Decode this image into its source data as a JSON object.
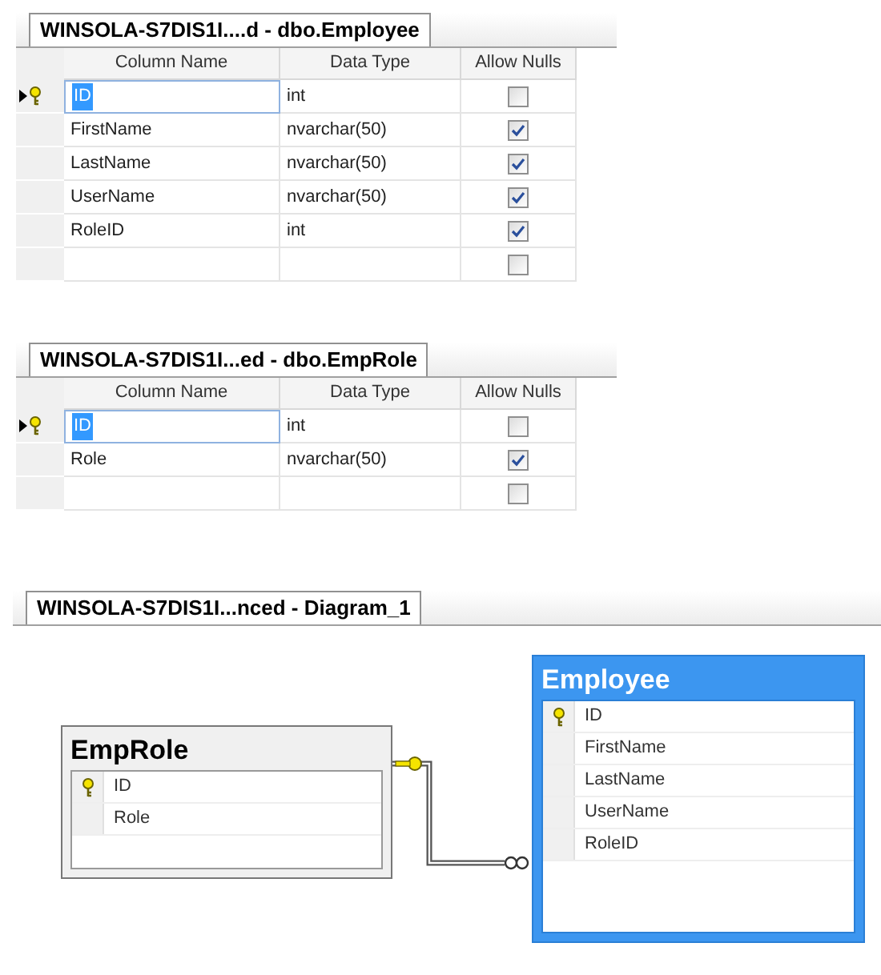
{
  "designers": [
    {
      "tab": "WINSOLA-S7DIS1I....d - dbo.Employee",
      "columns": [
        "Column Name",
        "Data Type",
        "Allow Nulls"
      ],
      "rows": [
        {
          "kind": "column",
          "column_name": "ID",
          "data_type": "int",
          "allow_nulls": false,
          "primary_key": true,
          "current": true
        },
        {
          "kind": "column",
          "column_name": "FirstName",
          "data_type": "nvarchar(50)",
          "allow_nulls": true,
          "primary_key": false,
          "current": false
        },
        {
          "kind": "column",
          "column_name": "LastName",
          "data_type": "nvarchar(50)",
          "allow_nulls": true,
          "primary_key": false,
          "current": false
        },
        {
          "kind": "column",
          "column_name": "UserName",
          "data_type": "nvarchar(50)",
          "allow_nulls": true,
          "primary_key": false,
          "current": false
        },
        {
          "kind": "column",
          "column_name": "RoleID",
          "data_type": "int",
          "allow_nulls": true,
          "primary_key": false,
          "current": false
        },
        {
          "kind": "new",
          "allow_nulls": false
        }
      ]
    },
    {
      "tab": "WINSOLA-S7DIS1I...ed - dbo.EmpRole",
      "columns": [
        "Column Name",
        "Data Type",
        "Allow Nulls"
      ],
      "rows": [
        {
          "kind": "column",
          "column_name": "ID",
          "data_type": "int",
          "allow_nulls": false,
          "primary_key": true,
          "current": true
        },
        {
          "kind": "column",
          "column_name": "Role",
          "data_type": "nvarchar(50)",
          "allow_nulls": true,
          "primary_key": false,
          "current": false
        },
        {
          "kind": "new",
          "allow_nulls": false
        }
      ]
    }
  ],
  "diagram": {
    "tab": "WINSOLA-S7DIS1I...nced - Diagram_1",
    "tables": [
      {
        "title": "EmpRole",
        "selected": false,
        "columns": [
          {
            "name": "ID",
            "primary_key": true
          },
          {
            "name": "Role",
            "primary_key": false
          }
        ]
      },
      {
        "title": "Employee",
        "selected": true,
        "columns": [
          {
            "name": "ID",
            "primary_key": true
          },
          {
            "name": "FirstName",
            "primary_key": false
          },
          {
            "name": "LastName",
            "primary_key": false
          },
          {
            "name": "UserName",
            "primary_key": false
          },
          {
            "name": "RoleID",
            "primary_key": false
          }
        ]
      }
    ]
  }
}
